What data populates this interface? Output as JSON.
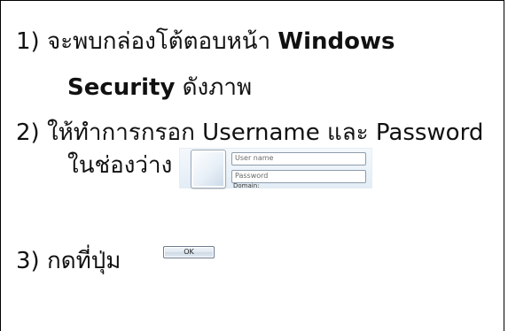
{
  "steps": {
    "step1": {
      "number": "1)",
      "text": "จะพบกล่องโต้ตอบหน้า",
      "bold1": "Windows",
      "bold2": "Security",
      "suffix": "ดังภาพ"
    },
    "step2": {
      "number": "2)",
      "text": "ให้ทำการกรอก Username และ Password",
      "line2": "ในช่องว่าง"
    },
    "step3": {
      "number": "3)",
      "text": "กดที่ปุ่ม"
    }
  },
  "credential_panel": {
    "username_placeholder": "User name",
    "password_placeholder": "Password",
    "domain_label": "Domain:"
  },
  "ok_button": {
    "label": "OK"
  }
}
